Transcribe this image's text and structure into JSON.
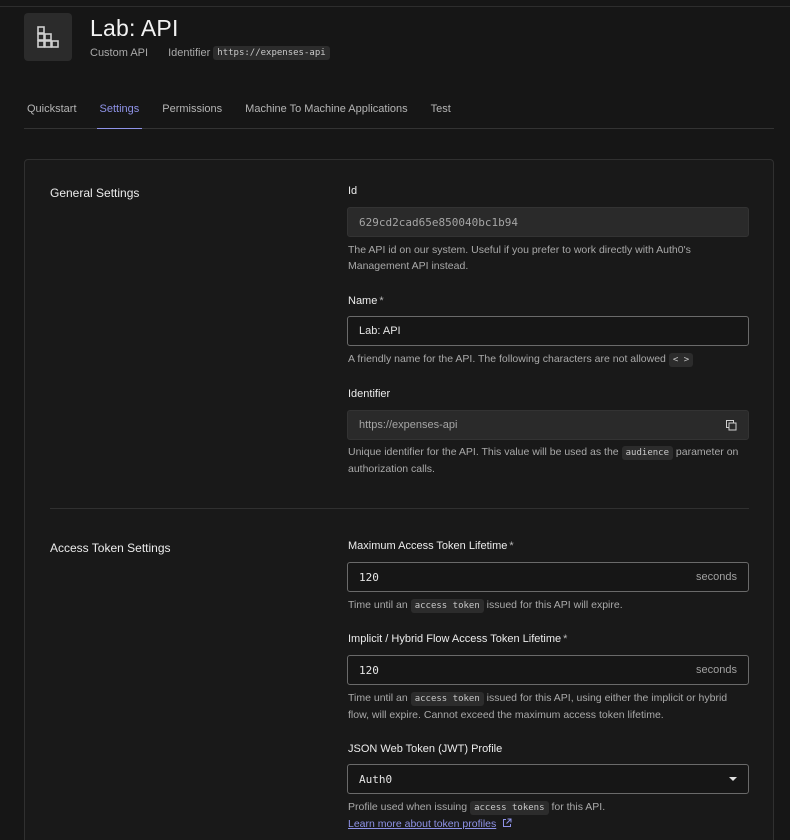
{
  "header": {
    "title": "Lab: API",
    "type": "Custom API",
    "identifier_label": "Identifier",
    "identifier_value": "https://expenses-api",
    "icon": "building-icon"
  },
  "tabs": [
    {
      "label": "Quickstart",
      "active": false
    },
    {
      "label": "Settings",
      "active": true
    },
    {
      "label": "Permissions",
      "active": false
    },
    {
      "label": "Machine To Machine Applications",
      "active": false
    },
    {
      "label": "Test",
      "active": false
    }
  ],
  "general": {
    "title": "General Settings",
    "id": {
      "label": "Id",
      "value": "629cd2cad65e850040bc1b94",
      "help": "The API id on our system. Useful if you prefer to work directly with Auth0's Management API instead."
    },
    "name": {
      "label": "Name",
      "required": "*",
      "value": "Lab: API",
      "help_prefix": "A friendly name for the API. The following characters are not allowed",
      "help_chip": "< >"
    },
    "identifier": {
      "label": "Identifier",
      "value": "https://expenses-api",
      "help_prefix": "Unique identifier for the API. This value will be used as the",
      "help_chip": "audience",
      "help_suffix": "parameter on authorization calls."
    }
  },
  "token": {
    "title": "Access Token Settings",
    "max_lifetime": {
      "label": "Maximum Access Token Lifetime",
      "required": "*",
      "value": "120",
      "unit": "seconds",
      "help_prefix": "Time until an",
      "help_chip": "access token",
      "help_suffix": "issued for this API will expire."
    },
    "implicit_lifetime": {
      "label": "Implicit / Hybrid Flow Access Token Lifetime",
      "required": "*",
      "value": "120",
      "unit": "seconds",
      "help_prefix": "Time until an",
      "help_chip": "access token",
      "help_suffix": "issued for this API, using either the implicit or hybrid flow, will expire. Cannot exceed the maximum access token lifetime."
    },
    "jwt_profile": {
      "label": "JSON Web Token (JWT) Profile",
      "value": "Auth0",
      "help_prefix": "Profile used when issuing",
      "help_chip": "access tokens",
      "help_suffix": "for this API.",
      "link": "Learn more about token profiles"
    }
  },
  "colors": {
    "accent": "#8f93e8",
    "background": "#161616",
    "panel": "#191919"
  }
}
